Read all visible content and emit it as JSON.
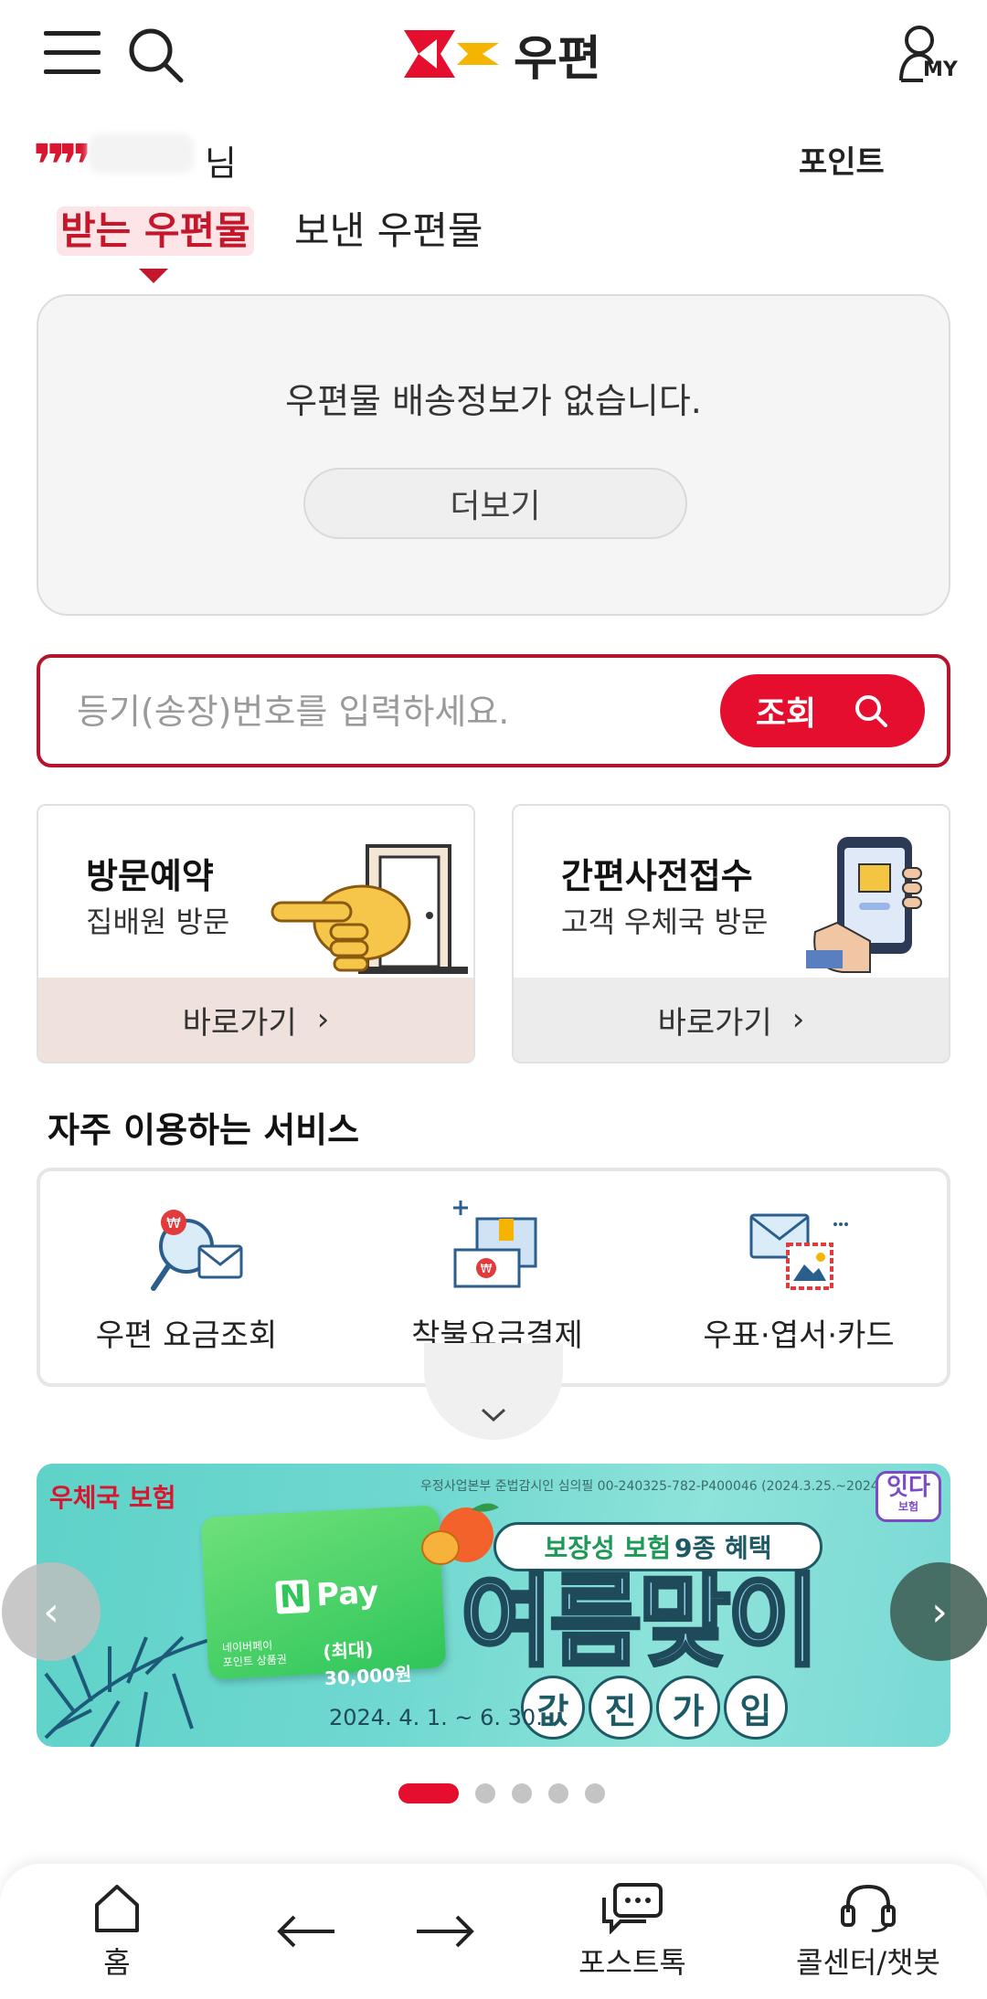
{
  "header": {
    "logo_text": "우편",
    "my_label": "MY",
    "icons": [
      "menu-icon",
      "search-icon",
      "user-icon"
    ]
  },
  "greeting": {
    "suffix": "님",
    "point_label": "포인트"
  },
  "tabs": [
    {
      "label": "받는 우편물",
      "active": true
    },
    {
      "label": "보낸 우편물",
      "active": false
    }
  ],
  "delivery": {
    "empty_message": "우편물 배송정보가 없습니다.",
    "more_label": "더보기"
  },
  "tracking": {
    "placeholder": "등기(송장)번호를 입력하세요.",
    "button_label": "조회"
  },
  "shortcuts": [
    {
      "title": "방문예약",
      "subtitle": "집배원 방문",
      "go_label": "바로가기",
      "go_bg": "#efe2dc"
    },
    {
      "title": "간편사전접수",
      "subtitle": "고객 우체국 방문",
      "go_label": "바로가기",
      "go_bg": "#ececec"
    }
  ],
  "frequent": {
    "title": "자주 이용하는 서비스",
    "items": [
      {
        "label": "우편 요금조회",
        "icon": "postage-search-icon"
      },
      {
        "label": "착불요금결제",
        "icon": "cod-payment-box-icon"
      },
      {
        "label": "우표·엽서·카드",
        "icon": "stamp-postcard-icon"
      }
    ]
  },
  "banner": {
    "brand": "우체국 보험",
    "fine_print": "우정사업본부 준법감시인 심의필 00-240325-782-P400046 (2024.3.25.~2024.6.30.)",
    "badge": "잇다",
    "badge_sub": "보험",
    "npay_label": "Pay",
    "npay_n": "N",
    "npay_desc_line1": "네이버페이",
    "npay_desc_line2": "포인트 상품권",
    "npay_amount": "(최대) 30,000원",
    "pill_highlight": "보장성 보험",
    "pill_rest": "9종 혜택",
    "headline": "여름맞이",
    "circles": [
      "값",
      "진",
      "가",
      "입"
    ],
    "date": "2024. 4. 1. ~ 6. 30.",
    "slide_count": 5,
    "active_slide": 0
  },
  "bottom_nav": [
    {
      "label": "홈",
      "icon": "home-icon"
    },
    {
      "label": "",
      "icon": "arrow-left-icon"
    },
    {
      "label": "",
      "icon": "arrow-right-icon"
    },
    {
      "label": "포스트톡",
      "icon": "chat-bubbles-icon"
    },
    {
      "label": "콜센터/챗봇",
      "icon": "headset-icon"
    }
  ],
  "colors": {
    "brand_red": "#e60e2e",
    "active_tab": "#c4172b",
    "border_red": "#b4152d"
  }
}
